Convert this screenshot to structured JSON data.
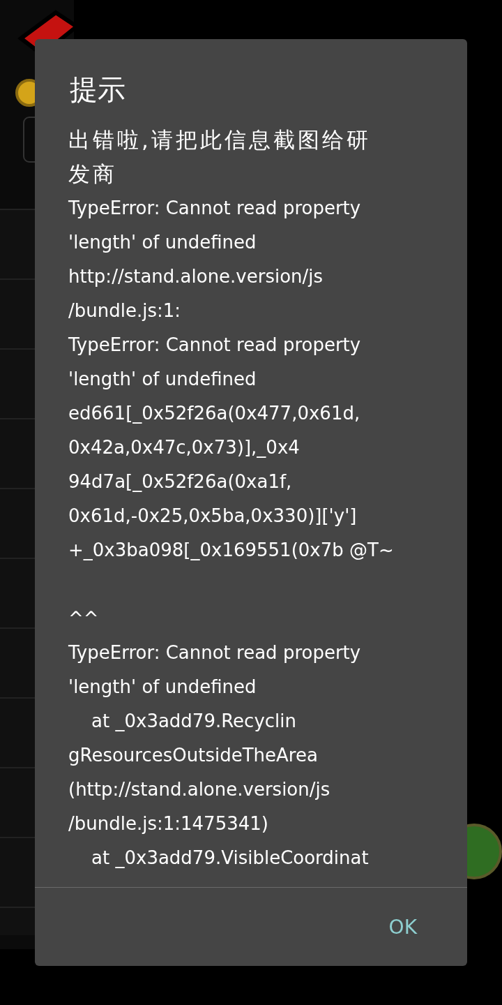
{
  "dialog": {
    "title": "提示",
    "message_paragraphs": [
      [
        "出错啦,请把此信息截图给研",
        "发商",
        "TypeError: Cannot read property",
        "'length' of undefined",
        "http://stand.alone.version/js",
        "/bundle.js:1:",
        "TypeError: Cannot read property",
        "'length' of undefined",
        "ed661[_0x52f26a(0x477,0x61d,",
        "0x42a,0x47c,0x73)],_0x4",
        "94d7a[_0x52f26a(0xa1f,",
        "0x61d,-0x25,0x5ba,0x330)]['y']",
        "+_0x3ba098[_0x169551(0x7b @T~"
      ],
      [
        "^^",
        "TypeError: Cannot read property",
        "'length' of undefined",
        "    at _0x3add79.Recyclin",
        "gResourcesOutsideTheArea",
        "(http://stand.alone.version/js",
        "/bundle.js:1:1475341)",
        "    at _0x3add79.VisibleCoordinat"
      ]
    ],
    "buttons": [
      "OK"
    ]
  }
}
